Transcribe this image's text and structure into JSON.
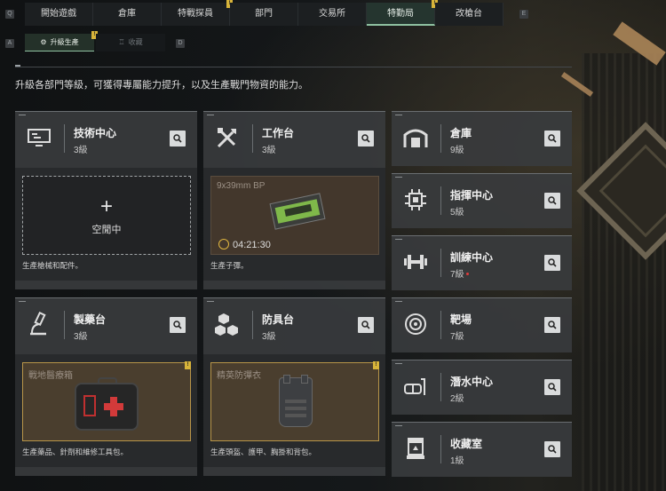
{
  "nav": {
    "key_left": "Q",
    "key_right": "E",
    "tabs": [
      {
        "label": "開始遊戲"
      },
      {
        "label": "倉庫"
      },
      {
        "label": "特戰探員"
      },
      {
        "label": "部門"
      },
      {
        "label": "交易所"
      },
      {
        "label": "特勤局"
      },
      {
        "label": "改槍台"
      }
    ],
    "active_tab": "特勤局"
  },
  "subnav": {
    "key_left": "A",
    "key_right": "D",
    "items": [
      {
        "label": "升級生產",
        "active": true
      },
      {
        "label": "收藏",
        "active": false
      }
    ]
  },
  "description": "升級各部門等級，可獲得專屬能力提升，以及生產戰門物資的能力。",
  "facilities": {
    "tech": {
      "title": "技術中心",
      "level": "3級",
      "slot_status": "空閒中",
      "desc": "生產槍械和配件。"
    },
    "workbench": {
      "title": "工作台",
      "level": "3級",
      "item": "9x39mm BP",
      "timer": "04:21:30",
      "desc": "生產子彈。"
    },
    "pharmacy": {
      "title": "製藥台",
      "level": "3級",
      "item": "戰地醫療箱",
      "desc": "生產藥品、針劑和維修工具包。"
    },
    "armor": {
      "title": "防具台",
      "level": "3級",
      "item": "精英防彈衣",
      "desc": "生產頭盔、護甲、胸掛和背包。"
    },
    "storage": {
      "title": "倉庫",
      "level": "9級"
    },
    "command": {
      "title": "指揮中心",
      "level": "5級"
    },
    "training": {
      "title": "訓練中心",
      "level": "7級"
    },
    "range": {
      "title": "靶場",
      "level": "7級"
    },
    "diving": {
      "title": "潛水中心",
      "level": "2級"
    },
    "collection": {
      "title": "收藏室",
      "level": "1級"
    }
  },
  "pin_mark": "!",
  "colors": {
    "accent": "#8fc1a1",
    "highlight": "#d8b43a",
    "alert": "#e23b3b"
  }
}
